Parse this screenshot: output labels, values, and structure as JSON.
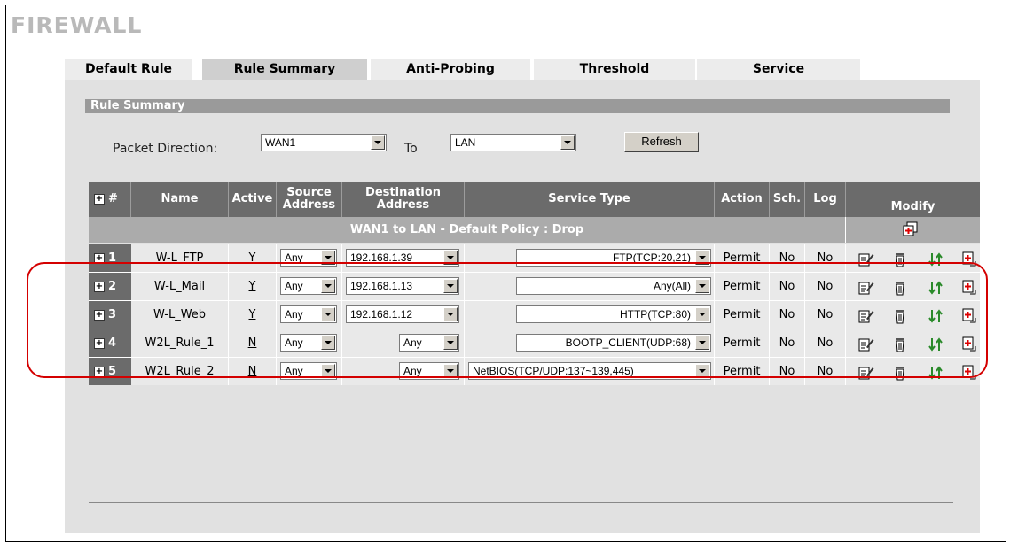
{
  "page": {
    "title": "FIREWALL"
  },
  "tabs": [
    {
      "label": "Default Rule",
      "active": false
    },
    {
      "label": "Rule Summary",
      "active": true
    },
    {
      "label": "Anti-Probing",
      "active": false
    },
    {
      "label": "Threshold",
      "active": false
    },
    {
      "label": "Service",
      "active": false
    }
  ],
  "section": {
    "header": "Rule Summary"
  },
  "filter": {
    "packet_direction_label": "Packet Direction:",
    "from_value": "WAN1",
    "to_label": "To",
    "to_value": "LAN",
    "refresh_label": "Refresh"
  },
  "table": {
    "headers": {
      "index": "#",
      "name": "Name",
      "active": "Active",
      "source": "Source Address",
      "destination": "Destination Address",
      "service": "Service Type",
      "action": "Action",
      "schedule": "Sch.",
      "log": "Log",
      "modify": "Modify"
    },
    "policy_text": "WAN1 to LAN - Default Policy : Drop",
    "rows": [
      {
        "index": "1",
        "name": "W-L_FTP",
        "active": "Y",
        "source": "Any",
        "destination": "192.168.1.39",
        "service": "FTP(TCP:20,21)",
        "action": "Permit",
        "schedule": "No",
        "log": "No"
      },
      {
        "index": "2",
        "name": "W-L_Mail",
        "active": "Y",
        "source": "Any",
        "destination": "192.168.1.13",
        "service": "Any(All)",
        "action": "Permit",
        "schedule": "No",
        "log": "No"
      },
      {
        "index": "3",
        "name": "W-L_Web",
        "active": "Y",
        "source": "Any",
        "destination": "192.168.1.12",
        "service": "HTTP(TCP:80)",
        "action": "Permit",
        "schedule": "No",
        "log": "No"
      },
      {
        "index": "4",
        "name": "W2L_Rule_1",
        "active": "N",
        "source": "Any",
        "destination": "Any",
        "service": "BOOTP_CLIENT(UDP:68)",
        "action": "Permit",
        "schedule": "No",
        "log": "No"
      },
      {
        "index": "5",
        "name": "W2L_Rule_2",
        "active": "N",
        "source": "Any",
        "destination": "Any",
        "service": "NetBIOS(TCP/UDP:137~139,445)",
        "action": "Permit",
        "schedule": "No",
        "log": "No"
      }
    ]
  },
  "icons": [
    "edit-icon",
    "delete-icon",
    "move-icon",
    "insert-icon",
    "append-rule-icon"
  ],
  "colors": {
    "highlight": "#d40000",
    "header_bg": "#6b6b6b",
    "panel_bg": "#e1e1e1",
    "title_gray": "#b9b9b9"
  }
}
